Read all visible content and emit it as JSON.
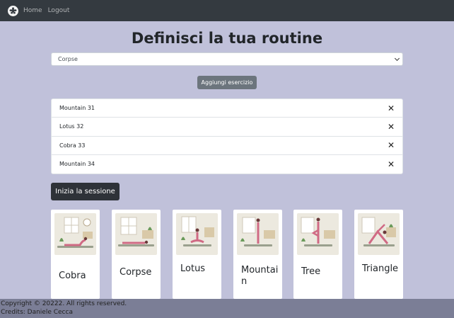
{
  "nav": {
    "home": "Home",
    "logout": "Logout"
  },
  "title": "Definisci la tua routine",
  "select": {
    "value": "Corpse"
  },
  "add_button": "Aggiungi esercizio",
  "routine": [
    {
      "label": "Mountain 31"
    },
    {
      "label": "Lotus 32"
    },
    {
      "label": "Cobra 33"
    },
    {
      "label": "Mountain 34"
    }
  ],
  "start_button": "Inizia la sessione",
  "poses": [
    {
      "name": "Cobra"
    },
    {
      "name": "Corpse"
    },
    {
      "name": "Lotus"
    },
    {
      "name": "Mountain"
    },
    {
      "name": "Tree"
    },
    {
      "name": "Triangle"
    }
  ],
  "footer": {
    "copyright": "Copyright © 20222. All rights reserved.",
    "credits": "Credits: Daniele Cecca"
  }
}
